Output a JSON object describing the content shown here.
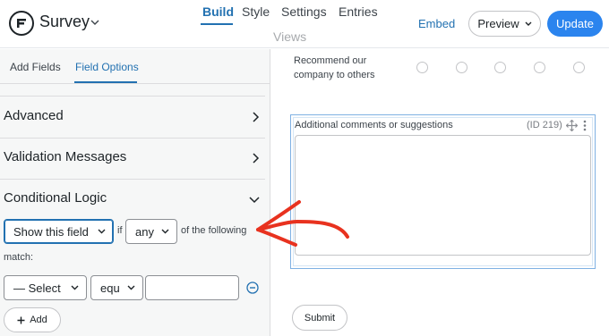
{
  "header": {
    "form_title": "Survey",
    "tabs": [
      {
        "label": "Build"
      },
      {
        "label": "Style"
      },
      {
        "label": "Settings"
      },
      {
        "label": "Entries"
      },
      {
        "label": "Views"
      }
    ],
    "embed_label": "Embed",
    "preview_label": "Preview",
    "update_label": "Update"
  },
  "sidebar": {
    "tabs": [
      {
        "label": "Add Fields"
      },
      {
        "label": "Field Options"
      }
    ],
    "sections": [
      {
        "label": "Advanced"
      },
      {
        "label": "Validation Messages"
      },
      {
        "label": "Conditional Logic"
      }
    ],
    "logic": {
      "action_value": "Show this field",
      "if_label": "if",
      "match_value": "any",
      "following_label": "of the following",
      "match_label": "match:",
      "field_select_value": "— Select",
      "operator_value": "equ",
      "value_input": "",
      "add_label": "Add"
    }
  },
  "preview": {
    "recommend_label": "Recommend our company to others",
    "field_label": "Additional comments or suggestions",
    "field_id": "(ID 219)",
    "comments_value": "",
    "submit_label": "Submit"
  },
  "colors": {
    "accent": "#2271b1",
    "update_button": "#2b84ee",
    "annotation_arrow": "#e8321f"
  }
}
